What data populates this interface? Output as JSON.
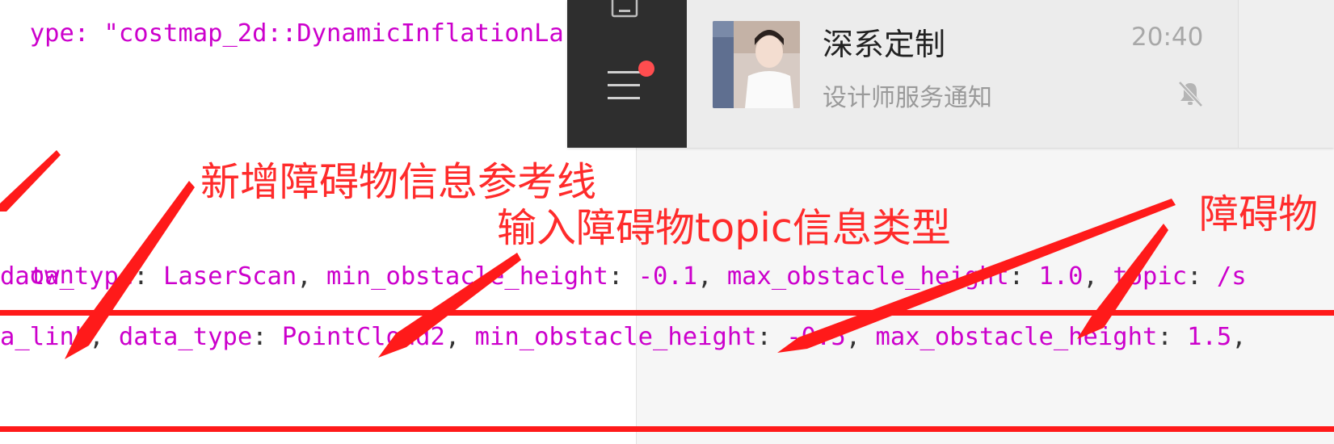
{
  "code": {
    "line_top": "ype: \"costmap_2d::DynamicInflationLa",
    "line_down": "own",
    "line_laser": {
      "k1": "data_type",
      "v1": "LaserScan",
      "k2": "min_obstacle_height",
      "v2": "-0.1",
      "k3": "max_obstacle_height",
      "v3": "1.0",
      "k4": "topic",
      "v4": "/s"
    },
    "line_cloud": {
      "k0": "a_link",
      "k1": "data_type",
      "v1": "PointCloud2",
      "k2": "min_obstacle_height",
      "v2": "-0.5",
      "k3": "max_obstacle_height",
      "v3": "1.5"
    }
  },
  "annotations": {
    "reference_line": "新增障碍物信息参考线",
    "topic_type": "输入障碍物topic信息类型",
    "obstacle": "障碍物"
  },
  "notification": {
    "title": "深系定制",
    "subtitle": "设计师服务通知",
    "time": "20:40"
  },
  "icons": {
    "mute": "mute-bell-icon",
    "menu": "menu-icon",
    "avatar": "avatar",
    "top": "document-icon"
  },
  "colors": {
    "annotation_red": "#ff1a1a",
    "code_magenta": "#cc00cc",
    "dark_sidebar": "#2e2e2e",
    "badge_red": "#ff4d4f"
  }
}
